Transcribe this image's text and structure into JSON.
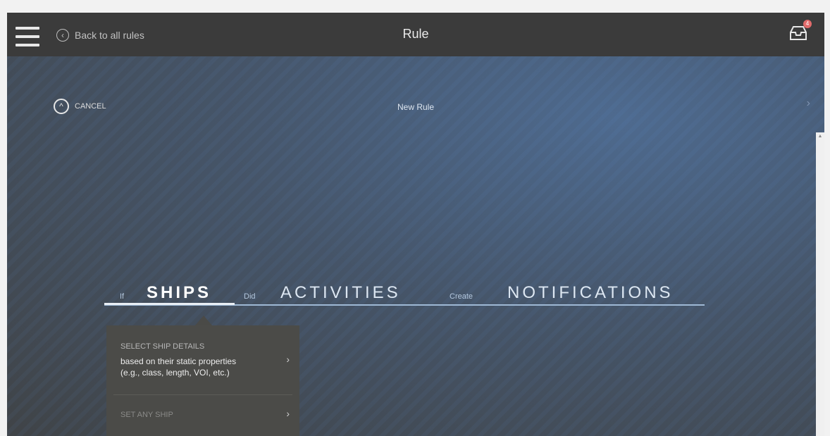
{
  "header": {
    "back_label": "Back to all rules",
    "title": "Rule",
    "inbox_badge": "4"
  },
  "subheader": {
    "cancel_label": "CANCEL",
    "page_label": "New Rule"
  },
  "steps": {
    "if_label": "If",
    "ships": "SHIPS",
    "did_label": "Did",
    "activities": "ACTIVITIES",
    "create_label": "Create",
    "notifications": "NOTIFICATIONS"
  },
  "dropdown": {
    "select_details_label": "SELECT SHIP DETAILS",
    "select_details_desc_line1": "based on their static properties",
    "select_details_desc_line2": "(e.g., class, length, VOI, etc.)",
    "set_any_ship_label": "SET ANY SHIP"
  },
  "icons": [
    "menu-icon",
    "back-circle-icon",
    "inbox-icon",
    "cancel-circle-icon",
    "chevron-right-icon"
  ],
  "colors": {
    "topbar": "#3b3b3b",
    "background": "#46566b",
    "accent_line": "#9fb9d5",
    "dropdown_bg": "#4b4b48",
    "badge": "#e26b6b"
  }
}
